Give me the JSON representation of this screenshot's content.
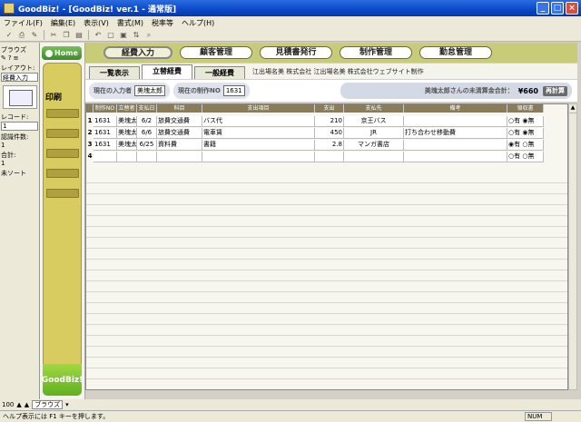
{
  "window": {
    "title": "GoodBiz! - [GoodBiz! ver.1 - 通常版]"
  },
  "menu": [
    "ファイル(F)",
    "編集(E)",
    "表示(V)",
    "書式(M)",
    "税率等",
    "ヘルプ(H)"
  ],
  "left_panel": {
    "browse_label": "ブラウズ",
    "layout_label": "レイアウト:",
    "layout_value": "経費入力",
    "record_label": "レコード:",
    "record_value": "1",
    "records_label": "認識件数:",
    "records_value": "1",
    "total_label": "合計:",
    "total_value": "1",
    "sort_label": "未ソート"
  },
  "nav": {
    "home": "Home",
    "print": "印刷",
    "logo": "GoodBiz!"
  },
  "top_tabs": [
    "経費入力",
    "顧客管理",
    "見積書発行",
    "制作管理",
    "勤怠管理"
  ],
  "sub_tabs": [
    "一覧表示",
    "立替経費",
    "一般経費"
  ],
  "path_text": "江出場名美 株式会社 江出場名美 株式会社ウェブサイト制作",
  "info": {
    "inputter_label": "現在の入力者",
    "inputter_value": "美塊太郎",
    "project_label": "現在の制作NO",
    "project_value": "1631",
    "unsettled_label": "美塊太郎さんの未清算金合計：",
    "unsettled_value": "¥660",
    "recalc_button": "再計算"
  },
  "table": {
    "headers": [
      "",
      "制作NO",
      "立替者",
      "支払日",
      "科目",
      "支出項目",
      "支出",
      "支払先",
      "備考",
      "領収書"
    ],
    "rows": [
      {
        "num": "1",
        "no": "1631",
        "payer": "美塊太",
        "date": "6/2",
        "account": "旅費交通費",
        "item": "バス代",
        "amount": "210",
        "payee": "京王バス",
        "note": "",
        "receipt": "○有 ◉無"
      },
      {
        "num": "2",
        "no": "1631",
        "payer": "美塊太",
        "date": "6/6",
        "account": "旅費交通費",
        "item": "電車賃",
        "amount": "450",
        "payee": "JR",
        "note": "打ち合わせ移動費",
        "receipt": "○有 ◉無"
      },
      {
        "num": "3",
        "no": "1631",
        "payer": "美塊太",
        "date": "6/25",
        "account": "資料費",
        "item": "書籍",
        "amount": "2.8",
        "payee": "マンガ書店",
        "note": "",
        "receipt": "◉有 ○無"
      },
      {
        "num": "4",
        "no": "",
        "payer": "",
        "date": "",
        "account": "",
        "item": "",
        "amount": "",
        "payee": "",
        "note": "",
        "receipt": "○有 ○無"
      }
    ]
  },
  "bottom": {
    "zoom": "100",
    "mode": "ブラウズ"
  },
  "status": {
    "help": "ヘルプ表示には F1 キーを押します。",
    "num": "NUM"
  }
}
